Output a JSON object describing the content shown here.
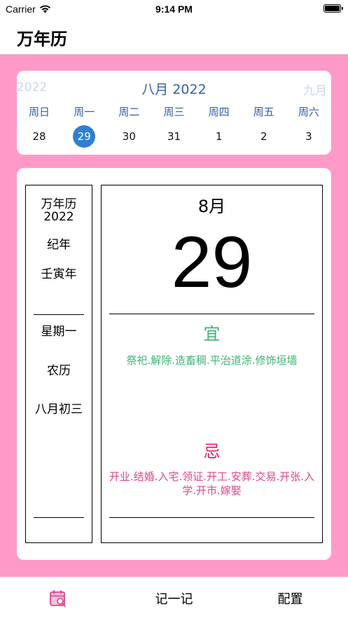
{
  "status_bar": {
    "carrier": "Carrier",
    "time": "9:14 PM"
  },
  "nav": {
    "title": "万年历"
  },
  "week_calendar": {
    "prev_year": "2022",
    "current_month": "八月 2022",
    "next_month": "九月",
    "weekdays": [
      "周日",
      "周一",
      "周二",
      "周三",
      "周四",
      "周五",
      "周六"
    ],
    "days": [
      "28",
      "29",
      "30",
      "31",
      "1",
      "2",
      "3"
    ],
    "selected_day": "29",
    "accent_color": "#2f7fd6"
  },
  "almanac": {
    "left": {
      "title": "万年历",
      "year": "2022",
      "era_label": "纪年",
      "ganzhi_year": "壬寅年",
      "weekday": "星期一",
      "lunar_label": "农历",
      "lunar_date": "八月初三"
    },
    "right": {
      "month": "8月",
      "day": "29",
      "yi_label": "宜",
      "yi_text": "祭祀.解除.造畜稠.平治道涂.修饰垣墙",
      "ji_label": "忌",
      "ji_text": "开业.结婚.入宅.领证.开工.安葬.交易.开张.入学.开市.嫁娶"
    }
  },
  "tabs": [
    {
      "label": "",
      "icon": "calendar-icon",
      "active": true
    },
    {
      "label": "记一记"
    },
    {
      "label": "配置"
    }
  ],
  "colors": {
    "background_pink": "#ff99c8",
    "yi_green": "#3cb371",
    "ji_pink": "#e0458e",
    "weekday_blue": "#2f5fb3"
  }
}
